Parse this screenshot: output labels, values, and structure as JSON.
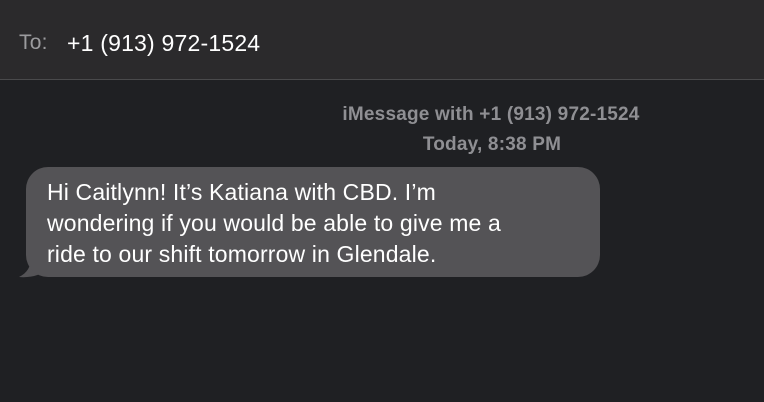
{
  "header": {
    "to_label": "To:",
    "recipient": "+1 (913) 972-1524"
  },
  "conversation": {
    "service_label": "iMessage with +1 (913) 972-1524",
    "timestamp": "Today, 8:38 PM",
    "messages": [
      {
        "direction": "incoming",
        "lines": [
          "Hi Caitlynn! It’s Katiana with CBD. I’m",
          "wondering if you would be able to give me a",
          "ride to our shift tomorrow in Glendale."
        ]
      }
    ]
  },
  "colors": {
    "background": "#1f2023",
    "header_background": "#2b2a2c",
    "incoming_bubble": "#545356",
    "meta_text": "#8f8f93"
  }
}
